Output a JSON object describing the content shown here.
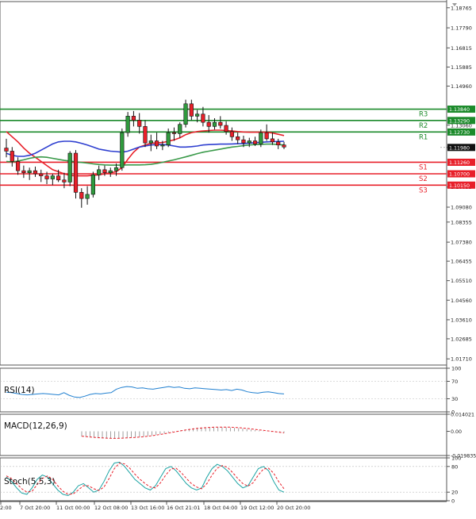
{
  "chart_data": [
    {
      "type": "candlestick",
      "panel": "price",
      "y_ticks": [
        "1.18765",
        "1.17790",
        "1.16815",
        "1.15885",
        "1.14960",
        "1.13060",
        "1.11980",
        "1.10055",
        "1.09080",
        "1.08355",
        "1.07380",
        "1.06455",
        "1.05510",
        "1.04560",
        "1.03610",
        "1.02685",
        "1.01710"
      ],
      "ylim": [
        1.0141,
        1.19065
      ],
      "current_price": "1.11980",
      "candles": [
        {
          "o": 1.1195,
          "h": 1.124,
          "l": 1.115,
          "c": 1.118
        },
        {
          "o": 1.118,
          "h": 1.12,
          "l": 1.1105,
          "c": 1.113
        },
        {
          "o": 1.113,
          "h": 1.115,
          "l": 1.1065,
          "c": 1.1085
        },
        {
          "o": 1.1085,
          "h": 1.111,
          "l": 1.105,
          "c": 1.1075
        },
        {
          "o": 1.1075,
          "h": 1.11,
          "l": 1.104,
          "c": 1.1085
        },
        {
          "o": 1.1085,
          "h": 1.1105,
          "l": 1.1055,
          "c": 1.107
        },
        {
          "o": 1.107,
          "h": 1.109,
          "l": 1.103,
          "c": 1.106
        },
        {
          "o": 1.106,
          "h": 1.108,
          "l": 1.102,
          "c": 1.1045
        },
        {
          "o": 1.1045,
          "h": 1.107,
          "l": 1.1015,
          "c": 1.106
        },
        {
          "o": 1.106,
          "h": 1.109,
          "l": 1.103,
          "c": 1.104
        },
        {
          "o": 1.104,
          "h": 1.1075,
          "l": 1.1,
          "c": 1.103
        },
        {
          "o": 1.103,
          "h": 1.118,
          "l": 1.101,
          "c": 1.117
        },
        {
          "o": 1.117,
          "h": 1.1185,
          "l": 1.095,
          "c": 1.098
        },
        {
          "o": 1.098,
          "h": 1.1,
          "l": 1.0905,
          "c": 1.095
        },
        {
          "o": 1.095,
          "h": 1.101,
          "l": 1.092,
          "c": 1.097
        },
        {
          "o": 1.097,
          "h": 1.108,
          "l": 1.0955,
          "c": 1.1065
        },
        {
          "o": 1.1065,
          "h": 1.111,
          "l": 1.104,
          "c": 1.109
        },
        {
          "o": 1.109,
          "h": 1.111,
          "l": 1.106,
          "c": 1.1075
        },
        {
          "o": 1.1075,
          "h": 1.11,
          "l": 1.1055,
          "c": 1.1085
        },
        {
          "o": 1.1085,
          "h": 1.112,
          "l": 1.106,
          "c": 1.11
        },
        {
          "o": 1.11,
          "h": 1.129,
          "l": 1.1085,
          "c": 1.127
        },
        {
          "o": 1.127,
          "h": 1.137,
          "l": 1.125,
          "c": 1.135
        },
        {
          "o": 1.135,
          "h": 1.1375,
          "l": 1.13,
          "c": 1.133
        },
        {
          "o": 1.133,
          "h": 1.1365,
          "l": 1.1265,
          "c": 1.13
        },
        {
          "o": 1.13,
          "h": 1.133,
          "l": 1.12,
          "c": 1.122
        },
        {
          "o": 1.122,
          "h": 1.126,
          "l": 1.118,
          "c": 1.123
        },
        {
          "o": 1.123,
          "h": 1.127,
          "l": 1.119,
          "c": 1.1205
        },
        {
          "o": 1.1205,
          "h": 1.123,
          "l": 1.1185,
          "c": 1.121
        },
        {
          "o": 1.121,
          "h": 1.129,
          "l": 1.12,
          "c": 1.127
        },
        {
          "o": 1.127,
          "h": 1.1295,
          "l": 1.123,
          "c": 1.1265
        },
        {
          "o": 1.1265,
          "h": 1.132,
          "l": 1.1245,
          "c": 1.131
        },
        {
          "o": 1.131,
          "h": 1.143,
          "l": 1.1295,
          "c": 1.141
        },
        {
          "o": 1.141,
          "h": 1.143,
          "l": 1.133,
          "c": 1.135
        },
        {
          "o": 1.135,
          "h": 1.138,
          "l": 1.132,
          "c": 1.136
        },
        {
          "o": 1.136,
          "h": 1.1395,
          "l": 1.13,
          "c": 1.132
        },
        {
          "o": 1.132,
          "h": 1.1355,
          "l": 1.127,
          "c": 1.13
        },
        {
          "o": 1.13,
          "h": 1.134,
          "l": 1.1285,
          "c": 1.132
        },
        {
          "o": 1.132,
          "h": 1.135,
          "l": 1.129,
          "c": 1.1305
        },
        {
          "o": 1.1305,
          "h": 1.1325,
          "l": 1.126,
          "c": 1.1275
        },
        {
          "o": 1.1275,
          "h": 1.1295,
          "l": 1.123,
          "c": 1.125
        },
        {
          "o": 1.125,
          "h": 1.127,
          "l": 1.1215,
          "c": 1.1235
        },
        {
          "o": 1.1235,
          "h": 1.1255,
          "l": 1.12,
          "c": 1.122
        },
        {
          "o": 1.122,
          "h": 1.1245,
          "l": 1.12,
          "c": 1.123
        },
        {
          "o": 1.123,
          "h": 1.125,
          "l": 1.1205,
          "c": 1.1215
        },
        {
          "o": 1.1215,
          "h": 1.1285,
          "l": 1.12,
          "c": 1.127
        },
        {
          "o": 1.127,
          "h": 1.131,
          "l": 1.123,
          "c": 1.124
        },
        {
          "o": 1.124,
          "h": 1.127,
          "l": 1.121,
          "c": 1.1225
        },
        {
          "o": 1.1225,
          "h": 1.124,
          "l": 1.119,
          "c": 1.121
        },
        {
          "o": 1.121,
          "h": 1.1225,
          "l": 1.119,
          "c": 1.12
        }
      ],
      "moving_averages": [
        {
          "color": "#e8202a",
          "values": [
            1.1275,
            1.125,
            1.1225,
            1.1195,
            1.117,
            1.115,
            1.113,
            1.111,
            1.109,
            1.108,
            1.107,
            1.1062,
            1.106,
            1.106,
            1.106,
            1.1063,
            1.1065,
            1.107,
            1.1075,
            1.108,
            1.11,
            1.114,
            1.1175,
            1.12,
            1.121,
            1.1218,
            1.122,
            1.1222,
            1.1228,
            1.1235,
            1.1245,
            1.126,
            1.127,
            1.1275,
            1.1278,
            1.128,
            1.1282,
            1.1282,
            1.128,
            1.1278,
            1.1275,
            1.1273,
            1.1272,
            1.1272,
            1.1272,
            1.1272,
            1.1268,
            1.1262,
            1.1256
          ]
        },
        {
          "color": "#2e3fd0",
          "values": [
            1.117,
            1.116,
            1.1155,
            1.1155,
            1.116,
            1.117,
            1.1185,
            1.12,
            1.1215,
            1.1225,
            1.1228,
            1.1228,
            1.1225,
            1.1218,
            1.121,
            1.12,
            1.119,
            1.1185,
            1.118,
            1.1178,
            1.1175,
            1.118,
            1.119,
            1.12,
            1.1205,
            1.121,
            1.1212,
            1.1212,
            1.121,
            1.1205,
            1.12,
            1.12,
            1.1202,
            1.1205,
            1.121,
            1.1212,
            1.1213,
            1.1214,
            1.1214,
            1.1215,
            1.1216,
            1.1217,
            1.1219,
            1.1221,
            1.1223,
            1.1225,
            1.1226,
            1.1227,
            1.1228
          ]
        },
        {
          "color": "#3a9a4a",
          "values": [
            1.113,
            1.1128,
            1.1132,
            1.1138,
            1.1145,
            1.115,
            1.1152,
            1.115,
            1.1145,
            1.114,
            1.1135,
            1.1132,
            1.1128,
            1.1125,
            1.1122,
            1.1118,
            1.1115,
            1.1113,
            1.1112,
            1.1112,
            1.1112,
            1.1113,
            1.1113,
            1.1113,
            1.1114,
            1.1116,
            1.112,
            1.1126,
            1.1132,
            1.1138,
            1.1145,
            1.1152,
            1.116,
            1.1168,
            1.1175,
            1.118,
            1.1185,
            1.119,
            1.1195,
            1.12,
            1.1203,
            1.1207,
            1.121,
            1.1212,
            1.1213,
            1.1214,
            1.1214,
            1.1212,
            1.121
          ]
        }
      ],
      "levels": [
        {
          "name": "R3",
          "value": 1.1384,
          "price_label": "1.13840",
          "color": "#1b8a2a"
        },
        {
          "name": "R2",
          "value": 1.1329,
          "price_label": "1.13290",
          "color": "#1b8a2a"
        },
        {
          "name": "R1",
          "value": 1.1273,
          "price_label": "1.12730",
          "color": "#1b8a2a"
        },
        {
          "name": "S1",
          "value": 1.1126,
          "price_label": "1.11260",
          "color": "#e8202a"
        },
        {
          "name": "S2",
          "value": 1.107,
          "price_label": "1.10700",
          "color": "#e8202a"
        },
        {
          "name": "S3",
          "value": 1.1015,
          "price_label": "1.10150",
          "color": "#e8202a"
        }
      ]
    },
    {
      "type": "line",
      "panel": "rsi",
      "title": "RSI(14)",
      "y_ticks": [
        "100",
        "70",
        "30",
        "0"
      ],
      "ylim": [
        0,
        100
      ],
      "values": [
        45,
        44,
        42,
        40,
        39,
        40,
        41,
        42,
        41,
        40,
        39,
        44,
        38,
        34,
        33,
        36,
        40,
        42,
        41,
        43,
        44,
        52,
        56,
        58,
        57,
        54,
        55,
        53,
        52,
        54,
        56,
        58,
        56,
        57,
        54,
        53,
        55,
        54,
        53,
        52,
        51,
        50,
        51,
        49,
        52,
        50,
        46,
        44,
        43,
        45,
        46,
        44,
        42,
        41
      ]
    },
    {
      "type": "histogram",
      "panel": "macd",
      "title": "MACD(12,26,9)",
      "y_ticks": [
        "0.014021",
        "0.00",
        "-0.019835"
      ],
      "ylim": [
        -0.019835,
        0.014021
      ],
      "histogram": [
        -0.0042,
        -0.0046,
        -0.005,
        -0.0053,
        -0.0056,
        -0.0058,
        -0.0059,
        -0.0059,
        -0.0058,
        -0.0057,
        -0.0055,
        -0.0052,
        -0.005,
        -0.0048,
        -0.0046,
        -0.0043,
        -0.0039,
        -0.0034,
        -0.0029,
        -0.0023,
        -0.0017,
        -0.001,
        -0.0004,
        0.0003,
        0.0009,
        0.0015,
        0.002,
        0.0025,
        0.0028,
        0.0031,
        0.0033,
        0.0034,
        0.0035,
        0.0035,
        0.0034,
        0.0033,
        0.0031,
        0.0029,
        0.0026,
        0.0023,
        0.0019,
        0.0015,
        0.0011,
        0.0007,
        0.0003,
        -0.0001,
        -0.0005,
        -0.0008,
        -0.0011,
        -0.0014
      ],
      "signal": [
        -0.004,
        -0.0043,
        -0.0046,
        -0.0049,
        -0.0052,
        -0.0054,
        -0.0056,
        -0.0057,
        -0.0058,
        -0.0057,
        -0.0056,
        -0.0054,
        -0.0052,
        -0.005,
        -0.0047,
        -0.0044,
        -0.004,
        -0.0036,
        -0.0031,
        -0.0026,
        -0.002,
        -0.0014,
        -0.0008,
        -0.0002,
        0.0004,
        0.001,
        0.0015,
        0.002,
        0.0024,
        0.0027,
        0.003,
        0.0032,
        0.0034,
        0.0035,
        0.0035,
        0.0035,
        0.0034,
        0.0032,
        0.003,
        0.0027,
        0.0024,
        0.002,
        0.0016,
        0.0012,
        0.0008,
        0.0004,
        0.0,
        -0.0004,
        -0.0008,
        -0.0012
      ]
    },
    {
      "type": "line",
      "panel": "stoch",
      "title": "Stoch(5,5,3)",
      "y_ticks": [
        "100",
        "80",
        "20",
        "0"
      ],
      "ylim": [
        0,
        100
      ],
      "series": [
        {
          "color": "#1aa3a3",
          "values": [
            55,
            45,
            30,
            18,
            15,
            30,
            50,
            60,
            55,
            40,
            25,
            15,
            12,
            20,
            35,
            40,
            30,
            20,
            25,
            45,
            70,
            88,
            90,
            80,
            65,
            50,
            40,
            30,
            25,
            35,
            55,
            75,
            80,
            70,
            55,
            40,
            30,
            25,
            30,
            55,
            75,
            85,
            80,
            70,
            55,
            40,
            30,
            35,
            55,
            75,
            80,
            70,
            45,
            25,
            20
          ]
        },
        {
          "color": "#e8202a",
          "dashed": true,
          "values": [
            58,
            52,
            40,
            28,
            20,
            22,
            38,
            52,
            58,
            50,
            35,
            22,
            15,
            16,
            25,
            35,
            35,
            28,
            24,
            32,
            52,
            75,
            88,
            86,
            76,
            62,
            50,
            40,
            32,
            30,
            42,
            60,
            74,
            76,
            66,
            52,
            40,
            32,
            28,
            40,
            60,
            76,
            82,
            78,
            66,
            52,
            40,
            34,
            42,
            60,
            74,
            76,
            64,
            44,
            28
          ]
        }
      ]
    },
    {
      "type": "time_axis",
      "panel": "x_labels",
      "labels": [
        "2:00",
        "7 Oct 20:00",
        "11 Oct 00:00",
        "12 Oct 08:00",
        "13 Oct 16:00",
        "16 Oct 21:01",
        "18 Oct 04:00",
        "19 Oct 12:00",
        "20 Oct 20:00"
      ]
    }
  ]
}
